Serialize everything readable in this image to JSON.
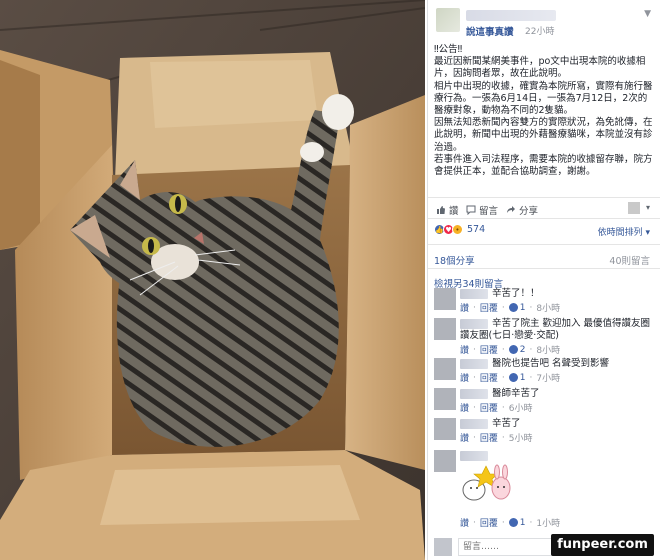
{
  "post": {
    "page_name": "說這事真讚",
    "time": "22小時",
    "chevron": "chevron-down-icon",
    "text_lines": [
      "‼公告‼",
      "最近因新聞某網美事件，po文中出現本院的收據相片，因詢問者眾，故在此說明。",
      "相片中出現的收據，確實為本院所寫，實際有施行醫療行為。一張為6月14日，一張為7月12日，2次的醫療對象，動物為不同的2隻貓。",
      "因無法知悉新聞內容雙方的實際狀況，為免訛傳，在此說明，新聞中出現的外藉醫療貓咪，本院並沒有診治過。",
      "若事件進入司法程序，需要本院的收據留存聯，院方會提供正本，並配合協助調查，謝謝。"
    ]
  },
  "actions": {
    "like": "讚",
    "comment": "留言",
    "share": "分享",
    "like_icon": "thumbs-up-icon",
    "comment_icon": "comment-icon",
    "share_icon": "share-icon"
  },
  "reactions": {
    "count": "574",
    "sort_label": "依時間排列",
    "icons": [
      "like-reaction-icon",
      "love-reaction-icon",
      "wow-reaction-icon"
    ]
  },
  "stats": {
    "shares": "18個分享",
    "comments": "40則留言",
    "more_comments": "檢視另34則留言"
  },
  "comments": [
    {
      "text": "辛苦了！！",
      "like": "讚",
      "reply": "回覆",
      "likes": "1",
      "time": "8小時"
    },
    {
      "text": "辛苦了院主 歡迎加入 最優值得讚友圈 讚友圈(七日·戀愛·交配)",
      "like": "讚",
      "reply": "回覆",
      "likes": "2",
      "time": "8小時"
    },
    {
      "text": "醫院也提告吧 名聲受到影響",
      "like": "讚",
      "reply": "回覆",
      "likes": "1",
      "time": "7小時"
    },
    {
      "text": "醫師辛苦了",
      "like": "讚",
      "reply": "回覆",
      "likes": "",
      "time": "6小時"
    },
    {
      "text": "辛苦了",
      "like": "讚",
      "reply": "回覆",
      "likes": "",
      "time": "5小時"
    },
    {
      "text": "",
      "like": "讚",
      "reply": "回覆",
      "likes": "1",
      "time": "1小時"
    }
  ],
  "composer": {
    "placeholder": "留言……"
  },
  "watermark": "funpeer.com",
  "colors": {
    "link": "#365899",
    "muted": "#90949c",
    "like": "#4267b2",
    "love": "#f0284a",
    "wow": "#f7b125"
  }
}
